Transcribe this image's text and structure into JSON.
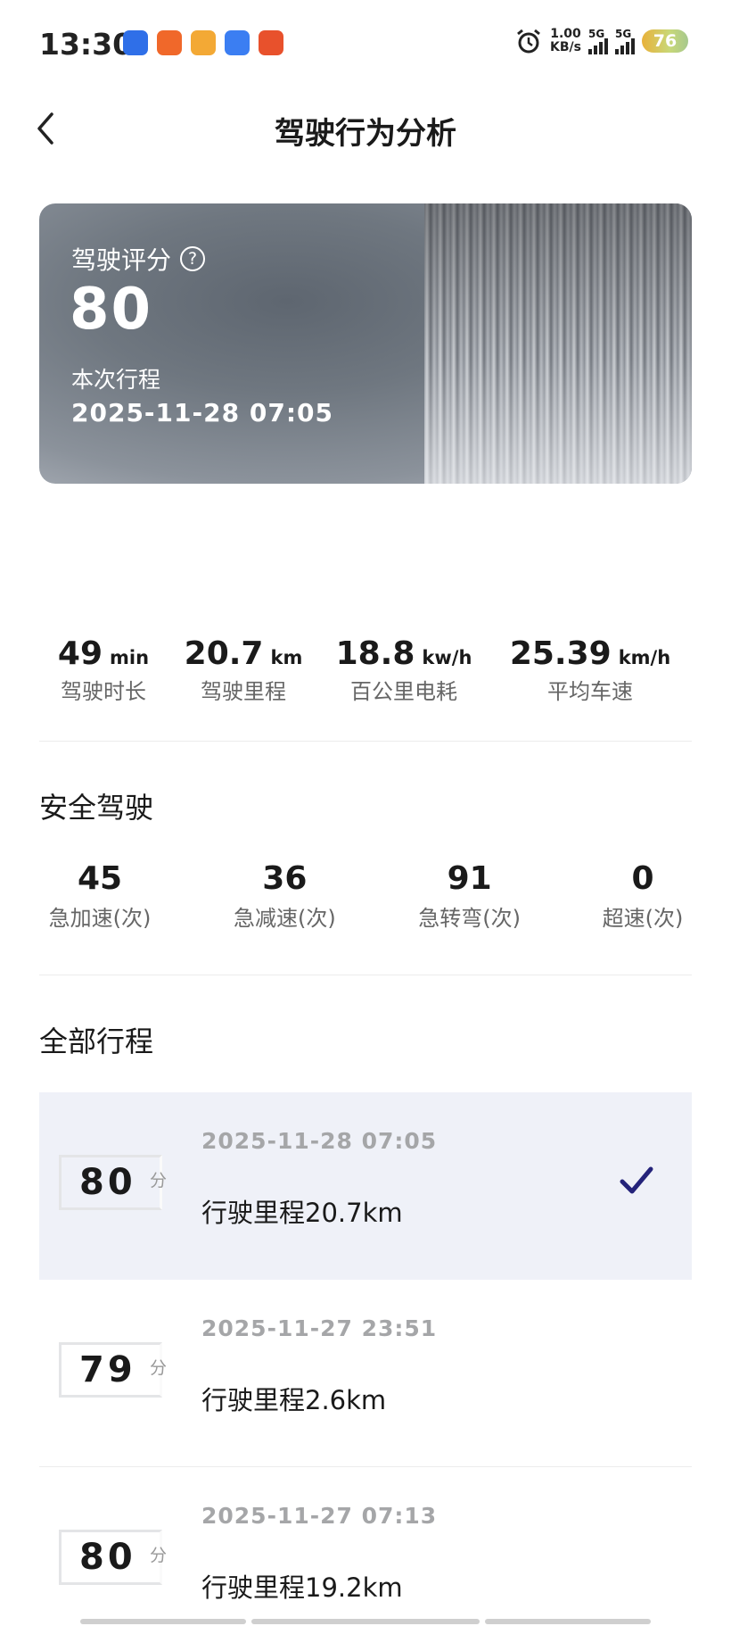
{
  "status_bar": {
    "time": "13:30",
    "app_icon_colors": [
      "#2f6fe8",
      "#f0682a",
      "#f3a935",
      "#3b7ef2",
      "#e8512c"
    ],
    "net_speed_value": "1.00",
    "net_speed_unit": "KB/s",
    "signal_1_label": "5G",
    "signal_2_label": "5G",
    "battery": "76"
  },
  "header": {
    "title": "驾驶行为分析"
  },
  "score_card": {
    "label": "驾驶评分",
    "help_glyph": "?",
    "score": "80",
    "trip_label": "本次行程",
    "trip_time": "2025-11-28   07:05"
  },
  "stats": [
    {
      "value": "49",
      "unit": "min",
      "label": "驾驶时长"
    },
    {
      "value": "20.7",
      "unit": "km",
      "label": "驾驶里程"
    },
    {
      "value": "18.8",
      "unit": "kw/h",
      "label": "百公里电耗"
    },
    {
      "value": "25.39",
      "unit": "km/h",
      "label": "平均车速"
    }
  ],
  "safety": {
    "title": "安全驾驶",
    "items": [
      {
        "value": "45",
        "label": "急加速(次)"
      },
      {
        "value": "36",
        "label": "急减速(次)"
      },
      {
        "value": "91",
        "label": "急转弯(次)"
      },
      {
        "value": "0",
        "label": "超速(次)"
      }
    ]
  },
  "trips_section": {
    "title": "全部行程",
    "score_unit": "分",
    "trips": [
      {
        "score": "80",
        "date": "2025-11-28  07:05",
        "distance": "行驶里程20.7km",
        "selected": true
      },
      {
        "score": "79",
        "date": "2025-11-27  23:51",
        "distance": "行驶里程2.6km",
        "selected": false
      },
      {
        "score": "80",
        "date": "2025-11-27  07:13",
        "distance": "行驶里程19.2km",
        "selected": false
      }
    ]
  },
  "colors": {
    "accent_check": "#24237a",
    "selected_row_bg": "#eff1f8"
  }
}
